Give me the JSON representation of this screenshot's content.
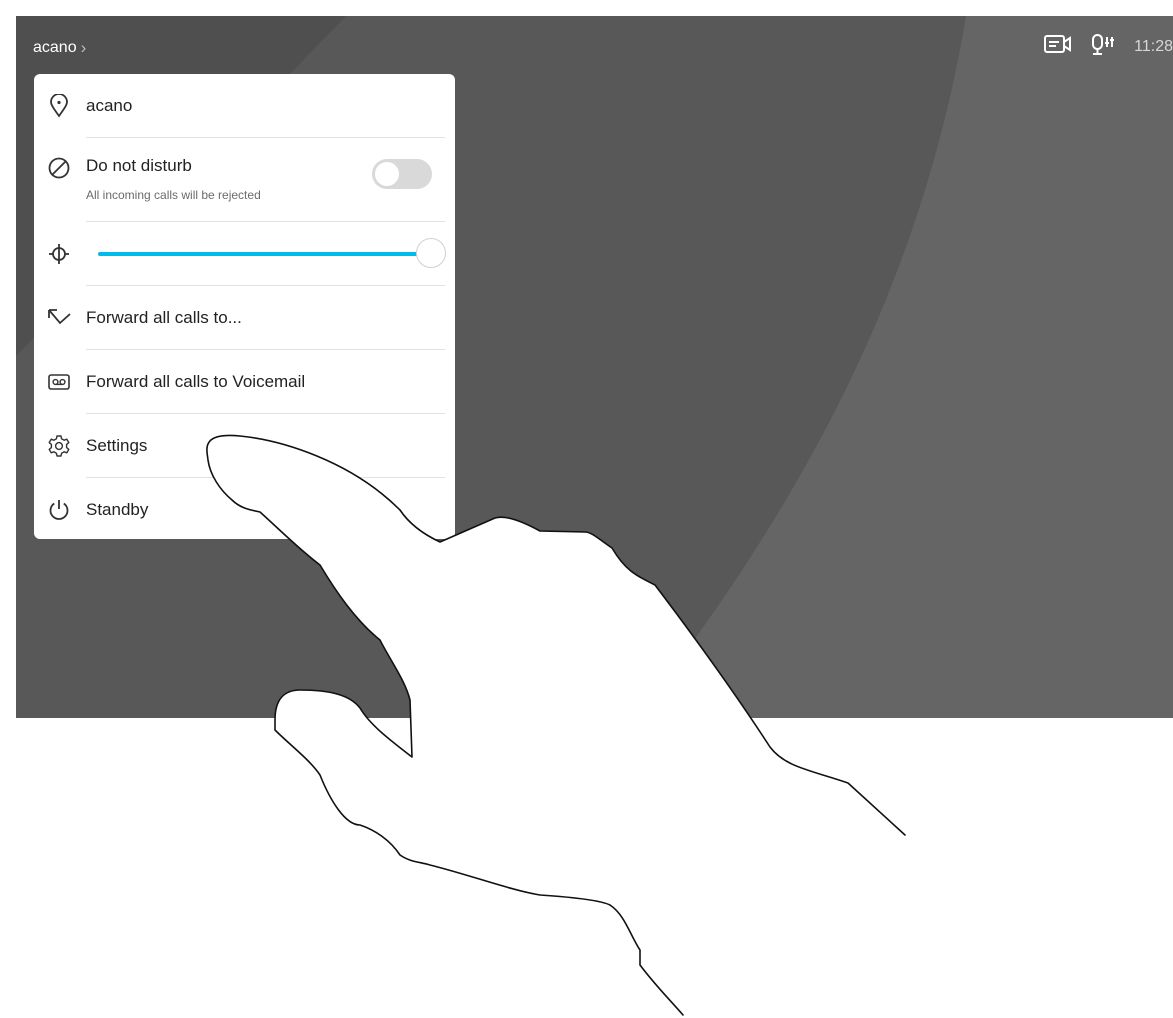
{
  "topbar": {
    "breadcrumb": "acano",
    "chevron": "›",
    "time": "11:28",
    "icons": [
      "camera-icon",
      "microphone-icon"
    ]
  },
  "menu": {
    "location": {
      "label": "acano",
      "icon": "location-pin-icon"
    },
    "dnd": {
      "label": "Do not disturb",
      "sublabel": "All incoming calls will be rejected",
      "icon": "prohibited-icon",
      "enabled": false
    },
    "brightness": {
      "icon": "brightness-icon",
      "level": 1.0
    },
    "forward": {
      "label": "Forward all calls to...",
      "icon": "forward-arrow-icon"
    },
    "voicemail": {
      "label": "Forward all calls to Voicemail",
      "icon": "voicemail-icon"
    },
    "settings": {
      "label": "Settings",
      "icon": "gear-icon"
    },
    "standby": {
      "label": "Standby",
      "icon": "power-icon"
    }
  },
  "colors": {
    "accent": "#00bceb",
    "screen_background": "#555555",
    "panel": "#ffffff"
  }
}
